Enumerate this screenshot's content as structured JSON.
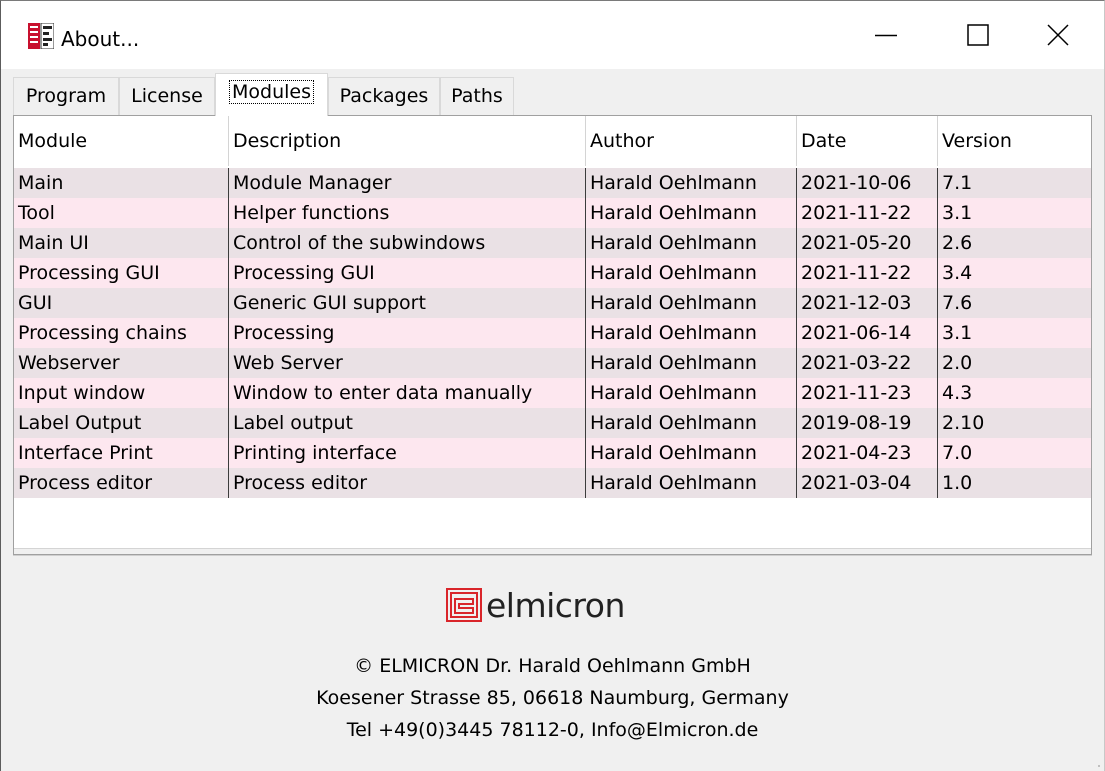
{
  "window": {
    "title": "About..."
  },
  "tabs": [
    {
      "label": "Program",
      "active": false
    },
    {
      "label": "License",
      "active": false
    },
    {
      "label": "Modules",
      "active": true
    },
    {
      "label": "Packages",
      "active": false
    },
    {
      "label": "Paths",
      "active": false
    }
  ],
  "table": {
    "columns": [
      "Module",
      "Description",
      "Author",
      "Date",
      "Version"
    ],
    "rows": [
      [
        "Main",
        "Module Manager",
        "Harald Oehlmann",
        "2021-10-06",
        "7.1"
      ],
      [
        "Tool",
        "Helper functions",
        "Harald Oehlmann",
        "2021-11-22",
        "3.1"
      ],
      [
        "Main UI",
        "Control of the subwindows",
        "Harald Oehlmann",
        "2021-05-20",
        "2.6"
      ],
      [
        "Processing GUI",
        "Processing GUI",
        "Harald Oehlmann",
        "2021-11-22",
        "3.4"
      ],
      [
        "GUI",
        "Generic GUI support",
        "Harald Oehlmann",
        "2021-12-03",
        "7.6"
      ],
      [
        "Processing chains",
        "Processing",
        "Harald Oehlmann",
        "2021-06-14",
        "3.1"
      ],
      [
        "Webserver",
        "Web Server",
        "Harald Oehlmann",
        "2021-03-22",
        "2.0"
      ],
      [
        "Input window",
        "Window to enter data manually",
        "Harald Oehlmann",
        "2021-11-23",
        "4.3"
      ],
      [
        "Label Output",
        "Label output",
        "Harald Oehlmann",
        "2019-08-19",
        "2.10"
      ],
      [
        "Interface Print",
        "Printing interface",
        "Harald Oehlmann",
        "2021-04-23",
        "7.0"
      ],
      [
        "Process editor",
        "Process editor",
        "Harald Oehlmann",
        "2021-03-04",
        "1.0"
      ]
    ]
  },
  "footer": {
    "logo_text": "elmicron",
    "company": "© ELMICRON Dr. Harald Oehlmann GmbH",
    "address": "Koesener Strasse 85, 06618 Naumburg, Germany",
    "contact": "Tel +49(0)3445 78112-0, Info@Elmicron.de"
  },
  "colors": {
    "row_even": "#eae1e5",
    "row_odd": "#fde7ef",
    "logo_red": "#d9252a"
  },
  "icons": {
    "app": "print-app-icon",
    "minimize": "minimize-icon",
    "maximize": "maximize-icon",
    "close": "close-icon"
  }
}
